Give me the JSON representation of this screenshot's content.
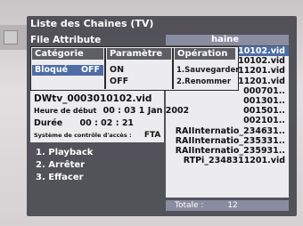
{
  "window": {
    "title": "Liste des Chaines (TV)"
  },
  "channel_list": {
    "header_partial": "haine",
    "items": [
      {
        "text": "10102.vid",
        "selected": true
      },
      {
        "text": "10102.vid",
        "selected": false
      },
      {
        "text": "11201.vid",
        "selected": false
      },
      {
        "text": "11201.vid",
        "selected": false
      },
      {
        "text": "000701..",
        "selected": false
      },
      {
        "text": "001301..",
        "selected": false
      },
      {
        "text": "001501..",
        "selected": false
      },
      {
        "text": "002101..",
        "selected": false
      },
      {
        "text": "RAIInternatio_234631..",
        "selected": false
      },
      {
        "text": "RAIInternatio_235331..",
        "selected": false
      },
      {
        "text": "RAIInternatio_235931..",
        "selected": false
      },
      {
        "text": "RTPi_2348311201.vid",
        "selected": false
      }
    ],
    "total_label": "Totale :",
    "total_value": "12"
  },
  "file_attribute": {
    "title": "File Attribute",
    "categorie": {
      "header": "Catégorie",
      "item_label": "Bloqué",
      "item_value": "OFF"
    },
    "parametre": {
      "header": "Paramètre",
      "on": "ON",
      "off": "OFF"
    },
    "operation": {
      "header": "Opération",
      "save": "1.Sauvegarder",
      "rename": "2.Renommer"
    }
  },
  "details": {
    "filename": "DWtv_0003010102.vid",
    "start_label": "Heure de début",
    "start_value": "00 : 03  1 Jan 2002",
    "duration_label": "Durée",
    "duration_value": "00 : 02 : 21",
    "access_label": "Système de contrôle d'accès :",
    "access_value": "FTA"
  },
  "actions": {
    "playback": "1. Playback",
    "stop": "2. Arrêter",
    "delete": "3. Effacer"
  },
  "colors": {
    "highlight": "#4e6da4",
    "header": "#8a8ca0",
    "panel": "#ececef",
    "osd": "#46464e"
  }
}
